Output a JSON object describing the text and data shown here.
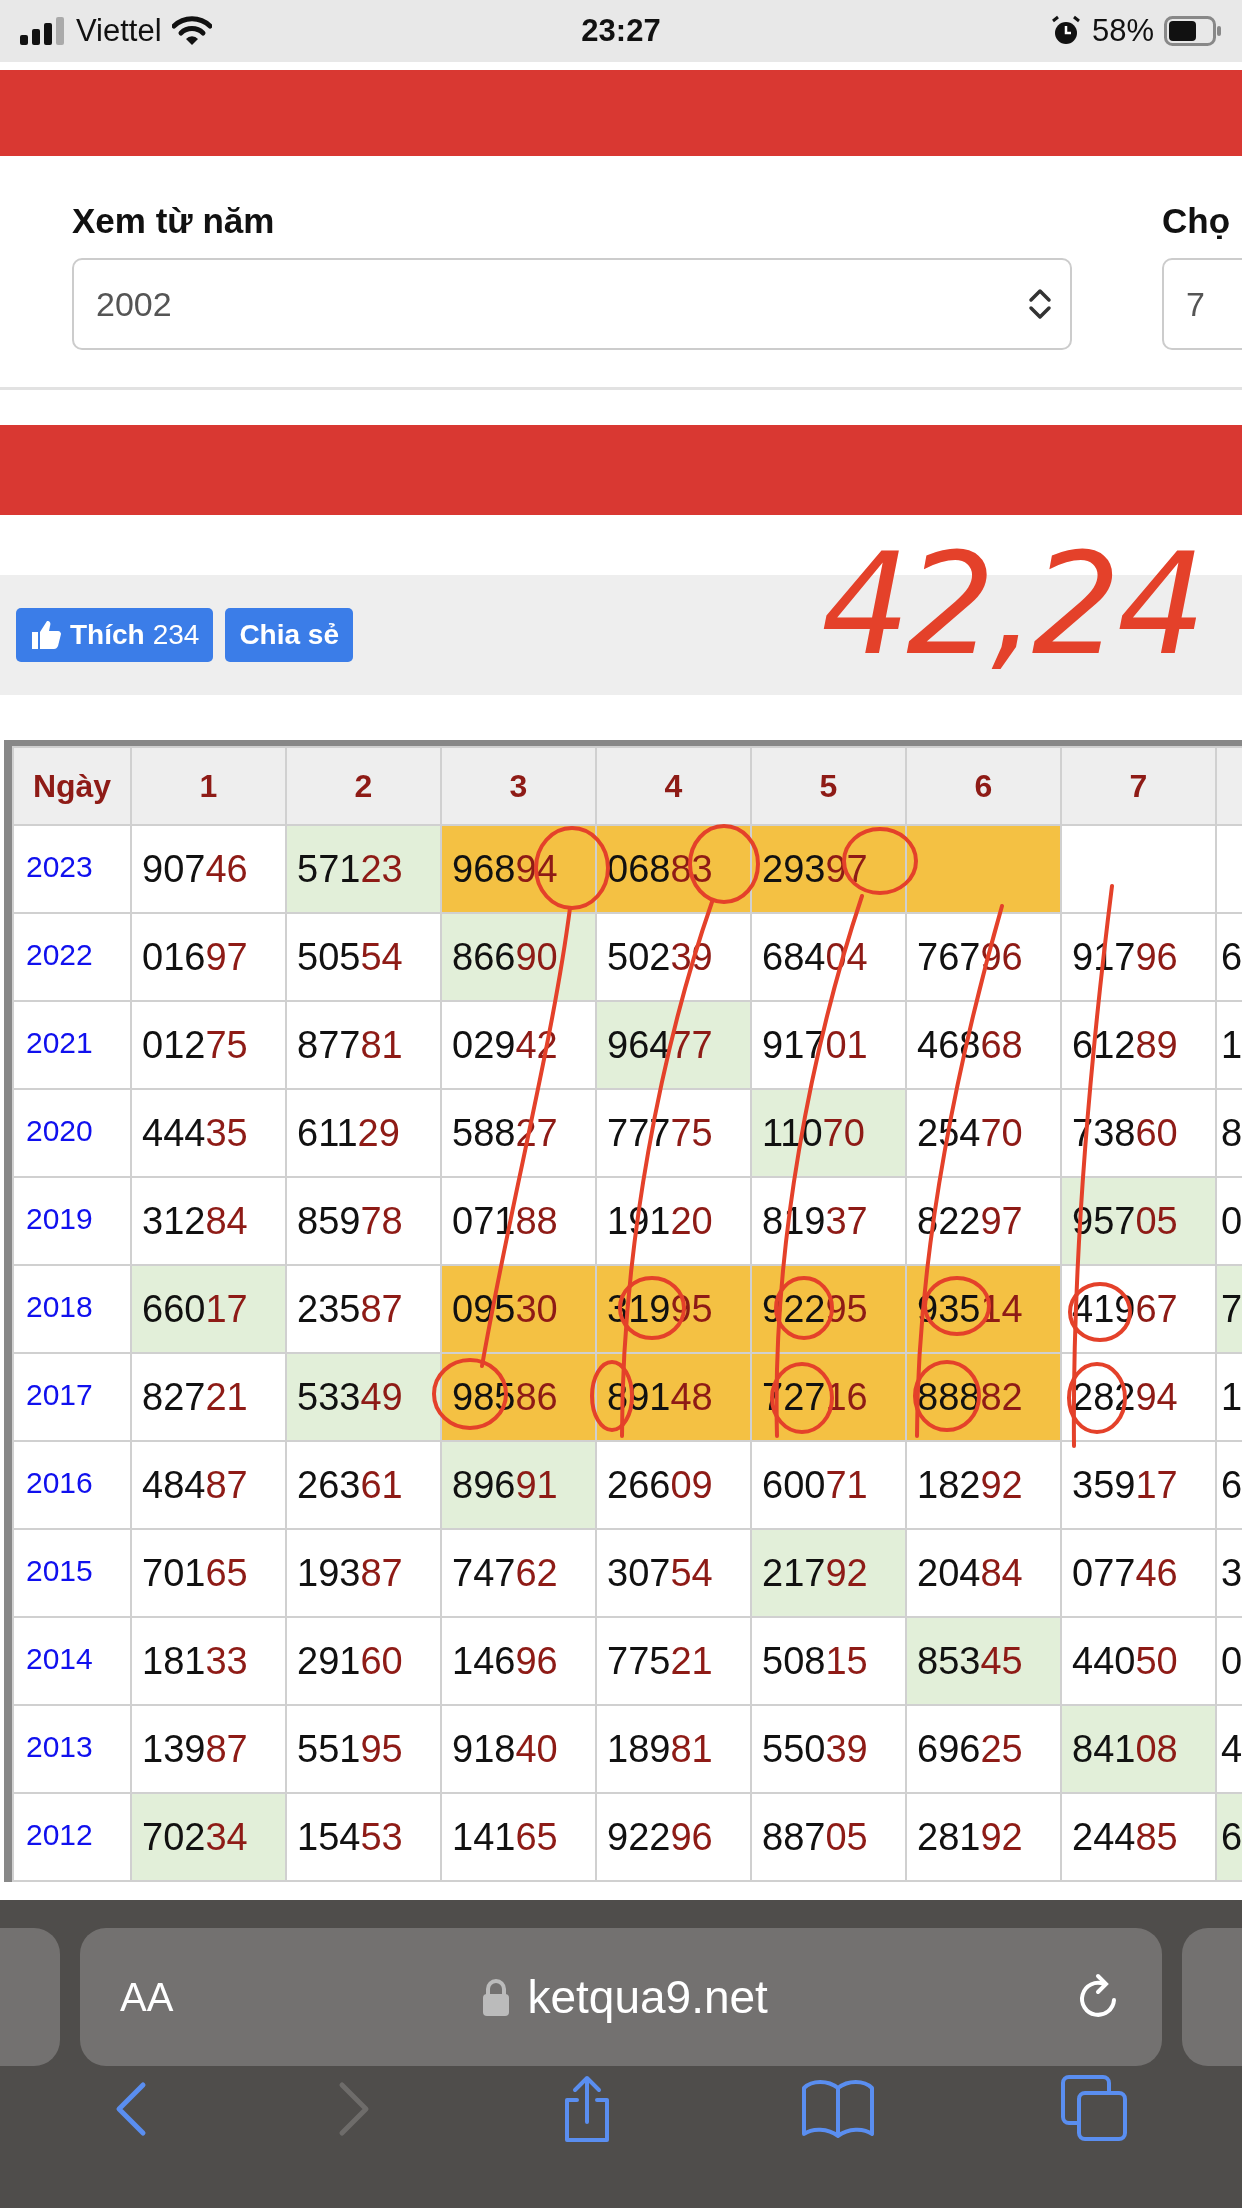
{
  "status_bar": {
    "carrier": "Viettel",
    "time": "23:27",
    "battery": "58%"
  },
  "filter": {
    "fields": [
      {
        "kind": "select",
        "label": "Xem từ năm",
        "value": "2002"
      },
      {
        "kind": "input",
        "label": "Chọ",
        "value": "7"
      }
    ]
  },
  "social": {
    "like": {
      "label": "Thích",
      "count": "234"
    },
    "share": {
      "label": "Chia sẻ"
    }
  },
  "annotation": {
    "text": "42,24"
  },
  "table": {
    "columns": [
      "Ngày",
      "1",
      "2",
      "3",
      "4",
      "5",
      "6",
      "7"
    ],
    "rows": [
      {
        "cells": [
          {
            "kind": "year",
            "text": "2023"
          },
          {
            "kind": "number",
            "text": "90746"
          },
          {
            "kind": "number",
            "text": "57123",
            "color": "#e2efd9"
          },
          {
            "kind": "number",
            "text": "96894",
            "color": "#f4c143"
          },
          {
            "kind": "number",
            "text": "06883",
            "color": "#f4c143"
          },
          {
            "kind": "number",
            "text": "29397",
            "color": "#f4c143"
          },
          {
            "kind": "empty",
            "color": "#f4c143"
          },
          {
            "kind": "empty"
          }
        ]
      },
      {
        "cells": [
          {
            "kind": "year",
            "text": "2022"
          },
          {
            "kind": "number",
            "text": "01697"
          },
          {
            "kind": "number",
            "text": "50554"
          },
          {
            "kind": "number",
            "text": "86690",
            "color": "#e2efd9"
          },
          {
            "kind": "number",
            "text": "50239"
          },
          {
            "kind": "number",
            "text": "68404"
          },
          {
            "kind": "number",
            "text": "76796"
          },
          {
            "kind": "number",
            "text": "91796"
          }
        ],
        "column_8": {
          "text": "6"
        }
      },
      {
        "cells": [
          {
            "kind": "year",
            "text": "2021"
          },
          {
            "kind": "number",
            "text": "01275"
          },
          {
            "kind": "number",
            "text": "87781"
          },
          {
            "kind": "number",
            "text": "02942"
          },
          {
            "kind": "number",
            "text": "96477",
            "color": "#e2efd9"
          },
          {
            "kind": "number",
            "text": "91701"
          },
          {
            "kind": "number",
            "text": "46868"
          },
          {
            "kind": "number",
            "text": "61289"
          }
        ],
        "column_8": {
          "text": "1"
        }
      },
      {
        "cells": [
          {
            "kind": "year",
            "text": "2020"
          },
          {
            "kind": "number",
            "text": "44435"
          },
          {
            "kind": "number",
            "text": "61129"
          },
          {
            "kind": "number",
            "text": "58827"
          },
          {
            "kind": "number",
            "text": "77775"
          },
          {
            "kind": "number",
            "text": "11070",
            "color": "#e2efd9"
          },
          {
            "kind": "number",
            "text": "25470"
          },
          {
            "kind": "number",
            "text": "73860"
          }
        ],
        "column_8": {
          "text": "8"
        }
      },
      {
        "cells": [
          {
            "kind": "year",
            "text": "2019"
          },
          {
            "kind": "number",
            "text": "31284"
          },
          {
            "kind": "number",
            "text": "85978"
          },
          {
            "kind": "number",
            "text": "07188"
          },
          {
            "kind": "number",
            "text": "19120"
          },
          {
            "kind": "number",
            "text": "81937"
          },
          {
            "kind": "number",
            "text": "82297"
          },
          {
            "kind": "number",
            "text": "95705",
            "color": "#e2efd9"
          }
        ],
        "column_8": {
          "text": "0"
        }
      },
      {
        "cells": [
          {
            "kind": "year",
            "text": "2018"
          },
          {
            "kind": "number",
            "text": "66017",
            "color": "#e2efd9"
          },
          {
            "kind": "number",
            "text": "23587"
          },
          {
            "kind": "number",
            "text": "09530",
            "color": "#f4c143"
          },
          {
            "kind": "number",
            "text": "31995",
            "color": "#f4c143"
          },
          {
            "kind": "number",
            "text": "92295",
            "color": "#f4c143"
          },
          {
            "kind": "number",
            "text": "93514",
            "color": "#f4c143"
          },
          {
            "kind": "number",
            "text": "41967"
          }
        ],
        "column_8": {
          "text": "7",
          "color": "#e2efd9"
        }
      },
      {
        "cells": [
          {
            "kind": "year",
            "text": "2017"
          },
          {
            "kind": "number",
            "text": "82721"
          },
          {
            "kind": "number",
            "text": "53349",
            "color": "#e2efd9"
          },
          {
            "kind": "number",
            "text": "98586",
            "color": "#f4c143"
          },
          {
            "kind": "number",
            "text": "89148",
            "color": "#f4c143"
          },
          {
            "kind": "number",
            "text": "72716",
            "color": "#f4c143"
          },
          {
            "kind": "number",
            "text": "88882",
            "color": "#f4c143"
          },
          {
            "kind": "number",
            "text": "28294"
          }
        ],
        "column_8": {
          "text": "1"
        }
      },
      {
        "cells": [
          {
            "kind": "year",
            "text": "2016"
          },
          {
            "kind": "number",
            "text": "48487"
          },
          {
            "kind": "number",
            "text": "26361"
          },
          {
            "kind": "number",
            "text": "89691",
            "color": "#e2efd9"
          },
          {
            "kind": "number",
            "text": "26609"
          },
          {
            "kind": "number",
            "text": "60071"
          },
          {
            "kind": "number",
            "text": "18292"
          },
          {
            "kind": "number",
            "text": "35917"
          }
        ],
        "column_8": {
          "text": "6"
        }
      },
      {
        "cells": [
          {
            "kind": "year",
            "text": "2015"
          },
          {
            "kind": "number",
            "text": "70165"
          },
          {
            "kind": "number",
            "text": "19387"
          },
          {
            "kind": "number",
            "text": "74762"
          },
          {
            "kind": "number",
            "text": "30754"
          },
          {
            "kind": "number",
            "text": "21792",
            "color": "#e2efd9"
          },
          {
            "kind": "number",
            "text": "20484"
          },
          {
            "kind": "number",
            "text": "07746"
          }
        ],
        "column_8": {
          "text": "3"
        }
      },
      {
        "cells": [
          {
            "kind": "year",
            "text": "2014"
          },
          {
            "kind": "number",
            "text": "18133"
          },
          {
            "kind": "number",
            "text": "29160"
          },
          {
            "kind": "number",
            "text": "14696"
          },
          {
            "kind": "number",
            "text": "77521"
          },
          {
            "kind": "number",
            "text": "50815"
          },
          {
            "kind": "number",
            "text": "85345",
            "color": "#e2efd9"
          },
          {
            "kind": "number",
            "text": "44050"
          }
        ],
        "column_8": {
          "text": "0"
        }
      },
      {
        "cells": [
          {
            "kind": "year",
            "text": "2013"
          },
          {
            "kind": "number",
            "text": "13987"
          },
          {
            "kind": "number",
            "text": "55195"
          },
          {
            "kind": "number",
            "text": "91840"
          },
          {
            "kind": "number",
            "text": "18981"
          },
          {
            "kind": "number",
            "text": "55039"
          },
          {
            "kind": "number",
            "text": "69625"
          },
          {
            "kind": "number",
            "text": "84108",
            "color": "#e2efd9"
          }
        ],
        "column_8": {
          "text": "4"
        }
      },
      {
        "cells": [
          {
            "kind": "year",
            "text": "2012"
          },
          {
            "kind": "number",
            "text": "70234",
            "color": "#e2efd9"
          },
          {
            "kind": "number",
            "text": "15453"
          },
          {
            "kind": "number",
            "text": "14165"
          },
          {
            "kind": "number",
            "text": "92296"
          },
          {
            "kind": "number",
            "text": "88705"
          },
          {
            "kind": "number",
            "text": "28192"
          },
          {
            "kind": "number",
            "text": "24485"
          }
        ],
        "column_8": {
          "text": "6",
          "color": "#e2efd9"
        }
      }
    ]
  },
  "browser": {
    "aa": "AA",
    "url": "ketqua9.net",
    "nav": [
      {
        "kind": "back",
        "disabled": false
      },
      {
        "kind": "forward",
        "disabled": true
      },
      {
        "kind": "share",
        "disabled": false
      },
      {
        "kind": "bookmarks",
        "disabled": false
      },
      {
        "kind": "tabs",
        "disabled": false
      }
    ]
  }
}
